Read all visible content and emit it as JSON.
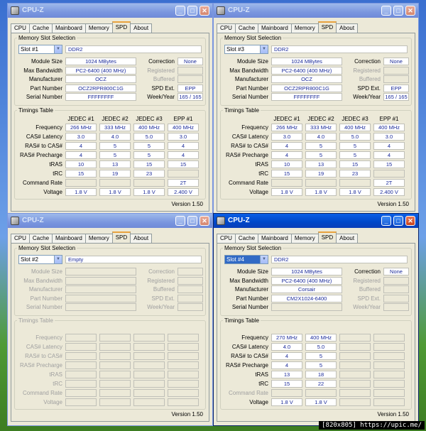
{
  "app_title": "CPU-Z",
  "tabs": [
    "CPU",
    "Cache",
    "Mainboard",
    "Memory",
    "SPD",
    "About"
  ],
  "section_memory": "Memory Slot Selection",
  "section_timings": "Timings Table",
  "labels": {
    "module_size": "Module Size",
    "max_bandwidth": "Max Bandwidth",
    "manufacturer": "Manufacturer",
    "part_number": "Part Number",
    "serial_number": "Serial Number",
    "correction": "Correction",
    "registered": "Registered",
    "buffered": "Buffered",
    "spd_ext": "SPD Ext.",
    "week_year": "Week/Year"
  },
  "timing_labels": [
    "Frequency",
    "CAS# Latency",
    "RAS# to CAS#",
    "RAS# Precharge",
    "tRAS",
    "tRC",
    "Command Rate",
    "Voltage"
  ],
  "version": "Version 1.50",
  "watermark": "[820x805] https://upic.me/",
  "windows": [
    {
      "slot": "Slot #1",
      "type": "DDR2",
      "module_size": "1024 MBytes",
      "max_bandwidth": "PC2-6400 (400 MHz)",
      "manufacturer": "OCZ",
      "part_number": "OCZ2RPR800C1G",
      "serial_number": "FFFFFFFF",
      "correction": "None",
      "registered": "",
      "buffered": "",
      "spd_ext": "EPP",
      "week_year": "165 / 165",
      "timing_cols": [
        "JEDEC #1",
        "JEDEC #2",
        "JEDEC #3",
        "EPP #1"
      ],
      "timings": [
        [
          "266 MHz",
          "333 MHz",
          "400 MHz",
          "400 MHz"
        ],
        [
          "3.0",
          "4.0",
          "5.0",
          "3.0"
        ],
        [
          "4",
          "5",
          "5",
          "4"
        ],
        [
          "4",
          "5",
          "5",
          "4"
        ],
        [
          "10",
          "13",
          "15",
          "15"
        ],
        [
          "15",
          "19",
          "23",
          ""
        ],
        [
          "",
          "",
          "",
          "2T"
        ],
        [
          "1.8 V",
          "1.8 V",
          "1.8 V",
          "2.400 V"
        ]
      ]
    },
    {
      "slot": "Slot #3",
      "type": "DDR2",
      "module_size": "1024 MBytes",
      "max_bandwidth": "PC2-6400 (400 MHz)",
      "manufacturer": "OCZ",
      "part_number": "OCZ2RPR800C1G",
      "serial_number": "FFFFFFFF",
      "correction": "None",
      "registered": "",
      "buffered": "",
      "spd_ext": "EPP",
      "week_year": "165 / 165",
      "timing_cols": [
        "JEDEC #1",
        "JEDEC #2",
        "JEDEC #3",
        "EPP #1"
      ],
      "timings": [
        [
          "266 MHz",
          "333 MHz",
          "400 MHz",
          "400 MHz"
        ],
        [
          "3.0",
          "4.0",
          "5.0",
          "3.0"
        ],
        [
          "4",
          "5",
          "5",
          "4"
        ],
        [
          "4",
          "5",
          "5",
          "4"
        ],
        [
          "10",
          "13",
          "15",
          "15"
        ],
        [
          "15",
          "19",
          "23",
          ""
        ],
        [
          "",
          "",
          "",
          "2T"
        ],
        [
          "1.8 V",
          "1.8 V",
          "1.8 V",
          "2.400 V"
        ]
      ]
    },
    {
      "slot": "Slot #2",
      "type": "Empty",
      "module_size": "",
      "max_bandwidth": "",
      "manufacturer": "",
      "part_number": "",
      "serial_number": "",
      "correction": "",
      "registered": "",
      "buffered": "",
      "spd_ext": "",
      "week_year": "",
      "timing_cols": [
        "",
        "",
        "",
        ""
      ],
      "timings": [
        [
          "",
          "",
          "",
          ""
        ],
        [
          "",
          "",
          "",
          ""
        ],
        [
          "",
          "",
          "",
          ""
        ],
        [
          "",
          "",
          "",
          ""
        ],
        [
          "",
          "",
          "",
          ""
        ],
        [
          "",
          "",
          "",
          ""
        ],
        [
          "",
          "",
          "",
          ""
        ],
        [
          "",
          "",
          "",
          ""
        ]
      ]
    },
    {
      "slot": "Slot #4",
      "type": "DDR2",
      "module_size": "1024 MBytes",
      "max_bandwidth": "PC2-6400 (400 MHz)",
      "manufacturer": "Corsair",
      "part_number": "CM2X1024-6400",
      "serial_number": "",
      "correction": "None",
      "registered": "",
      "buffered": "",
      "spd_ext": "",
      "week_year": "",
      "timing_cols": [
        "",
        "",
        "",
        ""
      ],
      "timings": [
        [
          "270 MHz",
          "400 MHz",
          "",
          ""
        ],
        [
          "4.0",
          "5.0",
          "",
          ""
        ],
        [
          "4",
          "5",
          "",
          ""
        ],
        [
          "4",
          "5",
          "",
          ""
        ],
        [
          "13",
          "18",
          "",
          ""
        ],
        [
          "15",
          "22",
          "",
          ""
        ],
        [
          "",
          "",
          "",
          ""
        ],
        [
          "1.8 V",
          "1.8 V",
          "",
          ""
        ]
      ]
    }
  ]
}
